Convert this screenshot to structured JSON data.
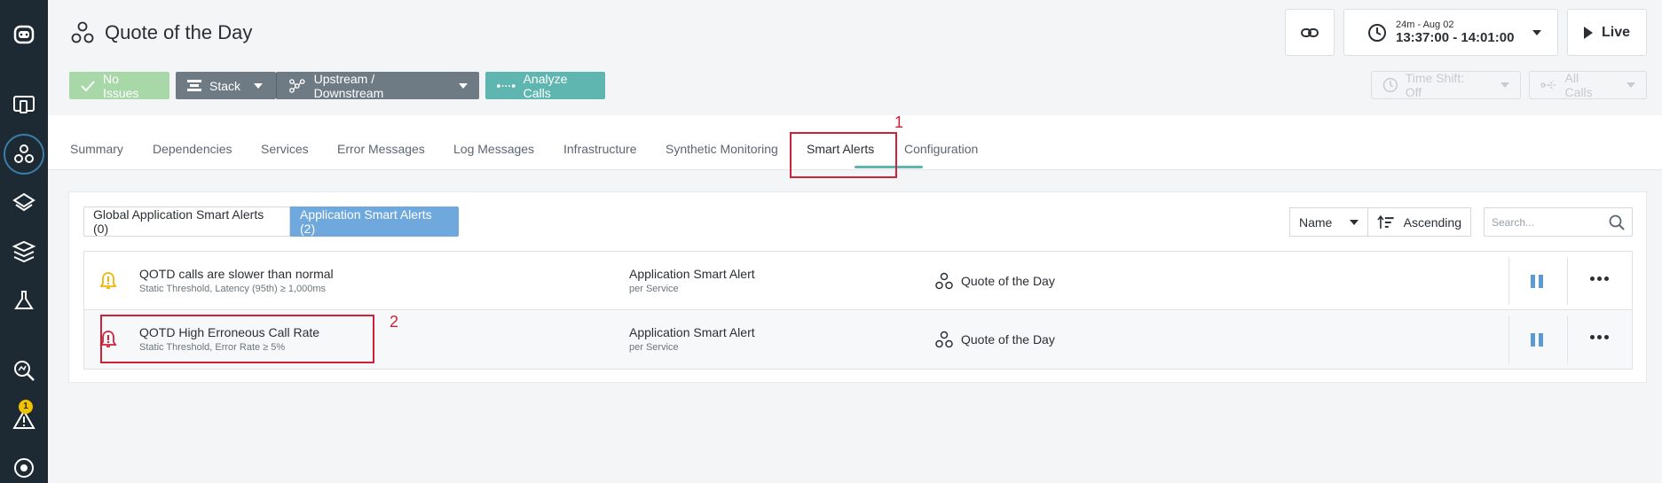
{
  "app": {
    "title": "Quote of the Day"
  },
  "header": {
    "time_range_small": "24m - Aug 02",
    "time_range_big": "13:37:00 - 14:01:00",
    "live_label": "Live"
  },
  "toolbar": {
    "no_issues_label": "No Issues",
    "stack_label": "Stack",
    "upstream_label": "Upstream / Downstream",
    "analyze_label": "Analyze Calls",
    "time_shift_label": "Time Shift: Off",
    "all_calls_label": "All Calls"
  },
  "tabs": [
    {
      "label": "Summary"
    },
    {
      "label": "Dependencies"
    },
    {
      "label": "Services"
    },
    {
      "label": "Error Messages"
    },
    {
      "label": "Log Messages"
    },
    {
      "label": "Infrastructure"
    },
    {
      "label": "Synthetic Monitoring"
    },
    {
      "label": "Smart Alerts"
    },
    {
      "label": "Configuration"
    }
  ],
  "active_tab": "Smart Alerts",
  "filters": {
    "global_label": "Global Application Smart Alerts (0)",
    "app_label": "Application Smart Alerts (2)",
    "sort_field": "Name",
    "sort_order": "Ascending",
    "search_placeholder": "Search..."
  },
  "alerts": [
    {
      "name": "QOTD calls are slower than normal",
      "subtitle": "Static Threshold, Latency (95th) ≥ 1,000ms",
      "type": "Application Smart Alert",
      "scope": "per Service",
      "application": "Quote of the Day",
      "severity_color": "#f0b400"
    },
    {
      "name": "QOTD High Erroneous Call Rate",
      "subtitle": "Static Threshold, Error Rate ≥ 5%",
      "type": "Application Smart Alert",
      "scope": "per Service",
      "application": "Quote of the Day",
      "severity_color": "#d0213a"
    }
  ],
  "nav": {
    "alert_badge_count": "1"
  },
  "annotations": {
    "box1_label": "1",
    "box2_label": "2"
  }
}
